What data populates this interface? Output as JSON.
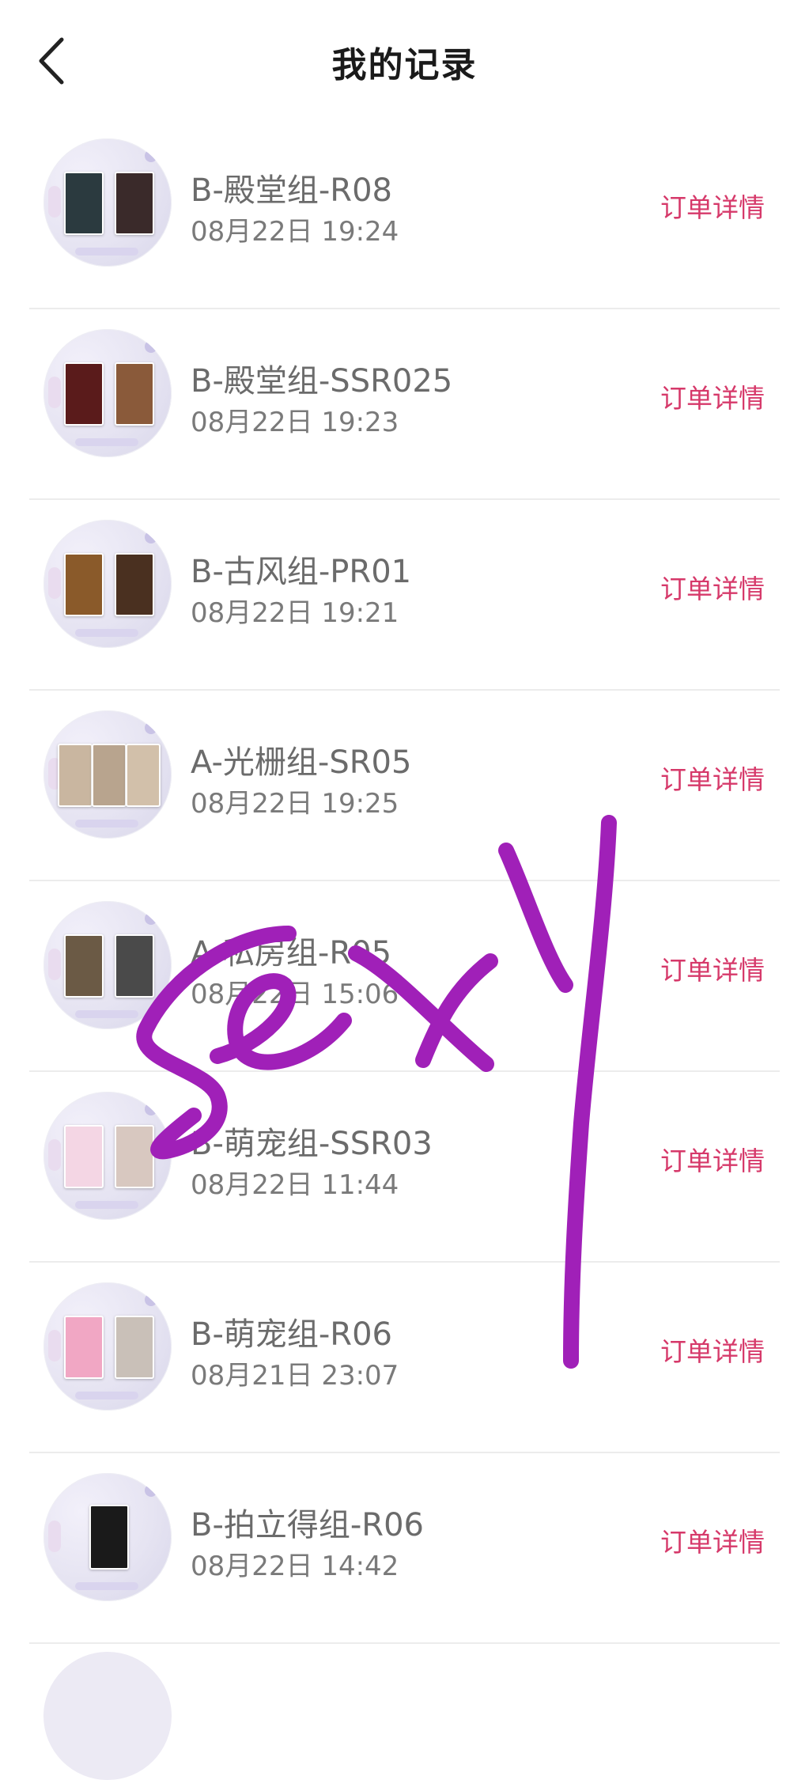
{
  "header": {
    "title": "我的记录"
  },
  "colors": {
    "accent": "#d6396a",
    "scribble": "#a020b8"
  },
  "records": [
    {
      "title": "B-殿堂组-R08",
      "time": "08月22日 19:24",
      "detail_label": "订单详情",
      "cards": [
        "#2b3a3f",
        "#3a2a2a"
      ]
    },
    {
      "title": "B-殿堂组-SSR025",
      "time": "08月22日 19:23",
      "detail_label": "订单详情",
      "cards": [
        "#5a1b1b",
        "#8a5a3a"
      ]
    },
    {
      "title": "B-古风组-PR01",
      "time": "08月22日 19:21",
      "detail_label": "订单详情",
      "cards": [
        "#8a5a2a",
        "#4a3020"
      ]
    },
    {
      "title": "A-光栅组-SR05",
      "time": "08月22日 19:25",
      "detail_label": "订单详情",
      "cards": [
        "#c9b6a0",
        "#b8a48e",
        "#d2c0aa"
      ]
    },
    {
      "title": "A-私房组-R05",
      "time": "08月22日 15:06",
      "detail_label": "订单详情",
      "cards": [
        "#6b5a45",
        "#4a4a4a"
      ]
    },
    {
      "title": "B-萌宠组-SSR03",
      "time": "08月22日 11:44",
      "detail_label": "订单详情",
      "cards": [
        "#f4d6e4",
        "#d8c8c0"
      ]
    },
    {
      "title": "B-萌宠组-R06",
      "time": "08月21日 23:07",
      "detail_label": "订单详情",
      "cards": [
        "#f1a7c4",
        "#c9c0b8"
      ]
    },
    {
      "title": "B-拍立得组-R06",
      "time": "08月22日 14:42",
      "detail_label": "订单详情",
      "cards": [
        "#1a1a1a"
      ]
    }
  ],
  "overlay": {
    "handwriting": "sexy"
  }
}
